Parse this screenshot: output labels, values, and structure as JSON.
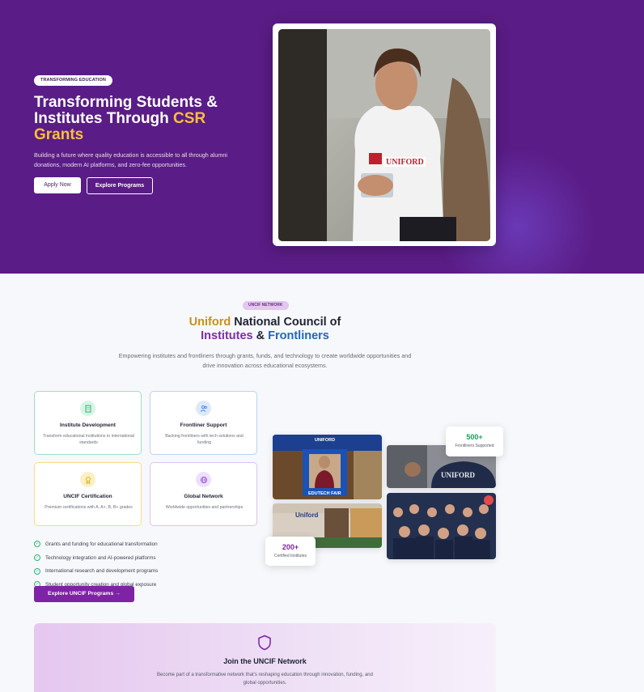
{
  "hero": {
    "badge": "TRANSFORMING EDUCATION",
    "title_main": "Transforming Students & Institutes Through ",
    "title_highlight": "CSR Grants",
    "subtitle": "Building a future where quality education is accessible to all through alumni donations, modern AI platforms, and zero-fee opportunities.",
    "apply_label": "Apply Now",
    "explore_label": "Explore Programs",
    "shirt_logo_text": "UNIFORD"
  },
  "network": {
    "badge": "UNCIF NETWORK",
    "title_part1": "Uniford",
    "title_part2": " National Council of",
    "title_part3": "Institutes",
    "title_part4": " & ",
    "title_part5": "Frontliners",
    "subtitle": "Empowering institutes and frontliners through grants, funds, and technology to create worldwide opportunities and drive innovation across educational ecosystems.",
    "cards": [
      {
        "title": "Institute Development",
        "desc": "Transform educational institutions to international standards",
        "icon": "building-icon",
        "color": "#2bb673"
      },
      {
        "title": "Frontliner Support",
        "desc": "Backing frontliners with tech solutions and funding",
        "icon": "users-icon",
        "color": "#3b82f6"
      },
      {
        "title": "UNCIF Certification",
        "desc": "Premium certifications with A, A+, B, B+ grades",
        "icon": "award-icon",
        "color": "#d9a30f"
      },
      {
        "title": "Global Network",
        "desc": "Worldwide opportunities and partnerships",
        "icon": "globe-icon",
        "color": "#9b51e0"
      }
    ],
    "checks": [
      "Grants and funding for educational transformation",
      "Technology integration and AI-powered platforms",
      "International research and development programs",
      "Student opportunity creation and global exposure"
    ],
    "cta_label": "Explore UNCIF Programs",
    "stat_frontliners": {
      "value": "500+",
      "label": "Frontliners Supported"
    },
    "stat_institutes": {
      "value": "200+",
      "label": "Certified Institutes"
    },
    "photo_texts": {
      "banner": "UNIFORD",
      "fair": "EDUTECH FAIR",
      "booth": "Uniford",
      "shirt": "UNIFORD"
    }
  },
  "join": {
    "title": "Join the UNCIF Network",
    "subtitle": "Become part of a transformative network that's reshaping education through innovation, funding, and global opportunities."
  },
  "colors": {
    "hero_bg": "#5a1c86",
    "accent_gold": "#fbbf3a",
    "primary_purple": "#7e22a6",
    "success_green": "#2bb673"
  }
}
